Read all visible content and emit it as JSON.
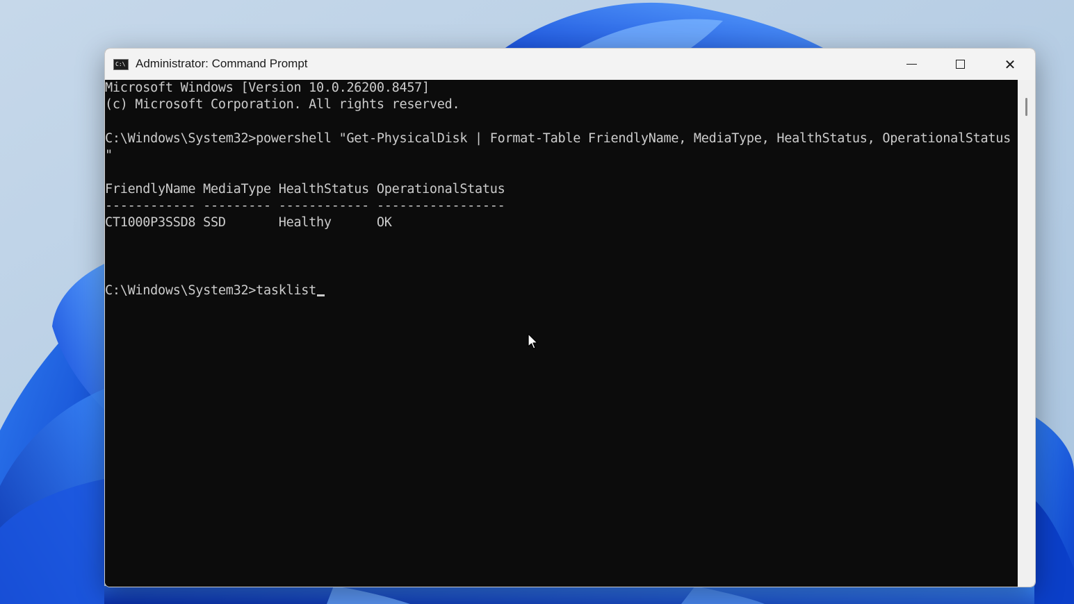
{
  "window": {
    "title": "Administrator: Command Prompt",
    "icon": "command-prompt-icon",
    "icon_glyph": "C:\\"
  },
  "controls": {
    "minimize": "minimize-icon",
    "maximize": "maximize-icon",
    "close": "close-icon",
    "close_glyph": "✕"
  },
  "console": {
    "lines": [
      "Microsoft Windows [Version 10.0.26200.8457]",
      "(c) Microsoft Corporation. All rights reserved.",
      "",
      "C:\\Windows\\System32>powershell \"Get-PhysicalDisk | Format-Table FriendlyName, MediaType, HealthStatus, OperationalStatus",
      "\"",
      "",
      "FriendlyName MediaType HealthStatus OperationalStatus",
      "------------ --------- ------------ -----------------",
      "CT1000P3SSD8 SSD       Healthy      OK",
      "",
      "",
      "",
      "C:\\Windows\\System32>tasklist"
    ]
  },
  "colors": {
    "console_bg": "#0c0c0c",
    "console_text": "#cccccc",
    "titlebar_bg": "#f3f3f3"
  }
}
